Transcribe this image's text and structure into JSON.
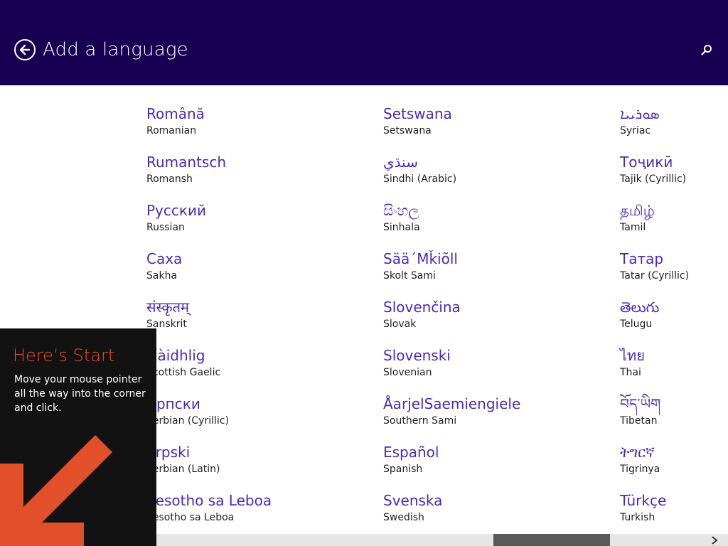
{
  "header": {
    "title": "Add a language",
    "back_icon": "back-arrow-circle-icon",
    "search_icon": "search-icon",
    "background": "#180052"
  },
  "languages": {
    "col1": [
      {
        "native": "Română",
        "english": "Romanian"
      },
      {
        "native": "Rumantsch",
        "english": "Romansh"
      },
      {
        "native": "Русский",
        "english": "Russian"
      },
      {
        "native": "Саха",
        "english": "Sakha"
      },
      {
        "native": "संस्कृतम्",
        "english": "Sanskrit"
      },
      {
        "native": "Gàidhlig",
        "english": "Scottish Gaelic"
      },
      {
        "native": "Српски",
        "english": "Serbian (Cyrillic)"
      },
      {
        "native": "Srpski",
        "english": "Serbian (Latin)"
      },
      {
        "native": "Sesotho sa Leboa",
        "english": "Sesotho sa Leboa"
      }
    ],
    "col2": [
      {
        "native": "Setswana",
        "english": "Setswana"
      },
      {
        "native": "سنڌي",
        "english": "Sindhi (Arabic)"
      },
      {
        "native": "සිංහල",
        "english": "Sinhala"
      },
      {
        "native": "Sää´Mǩiõll",
        "english": "Skolt Sami"
      },
      {
        "native": "Slovenčina",
        "english": "Slovak"
      },
      {
        "native": "Slovenski",
        "english": "Slovenian"
      },
      {
        "native": "ÅarjelSaemiengiele",
        "english": "Southern Sami"
      },
      {
        "native": "Español",
        "english": "Spanish"
      },
      {
        "native": "Svenska",
        "english": "Swedish"
      }
    ],
    "col3": [
      {
        "native": "ܣܘܪܝܝܐ",
        "english": "Syriac"
      },
      {
        "native": "Тоҷикӣ",
        "english": "Tajik (Cyrillic)"
      },
      {
        "native": "தமிழ்",
        "english": "Tamil"
      },
      {
        "native": "Татар",
        "english": "Tatar (Cyrillic)"
      },
      {
        "native": "తెలుగు",
        "english": "Telugu"
      },
      {
        "native": "ไทย",
        "english": "Thai"
      },
      {
        "native": "བོད་ཡིག",
        "english": "Tibetan"
      },
      {
        "native": "ትግርኛ",
        "english": "Tigrinya"
      },
      {
        "native": "Türkçe",
        "english": "Turkish"
      }
    ]
  },
  "tip": {
    "title": "Here’s Start",
    "body": "Move your mouse pointer all the way into the corner and click.",
    "arrow_icon": "corner-arrow-icon",
    "accent": "#e2502a"
  },
  "scrollbar": {
    "right_icon": "chevron-right-icon"
  },
  "colors": {
    "link": "#4a2ab8",
    "text": "#222222"
  }
}
